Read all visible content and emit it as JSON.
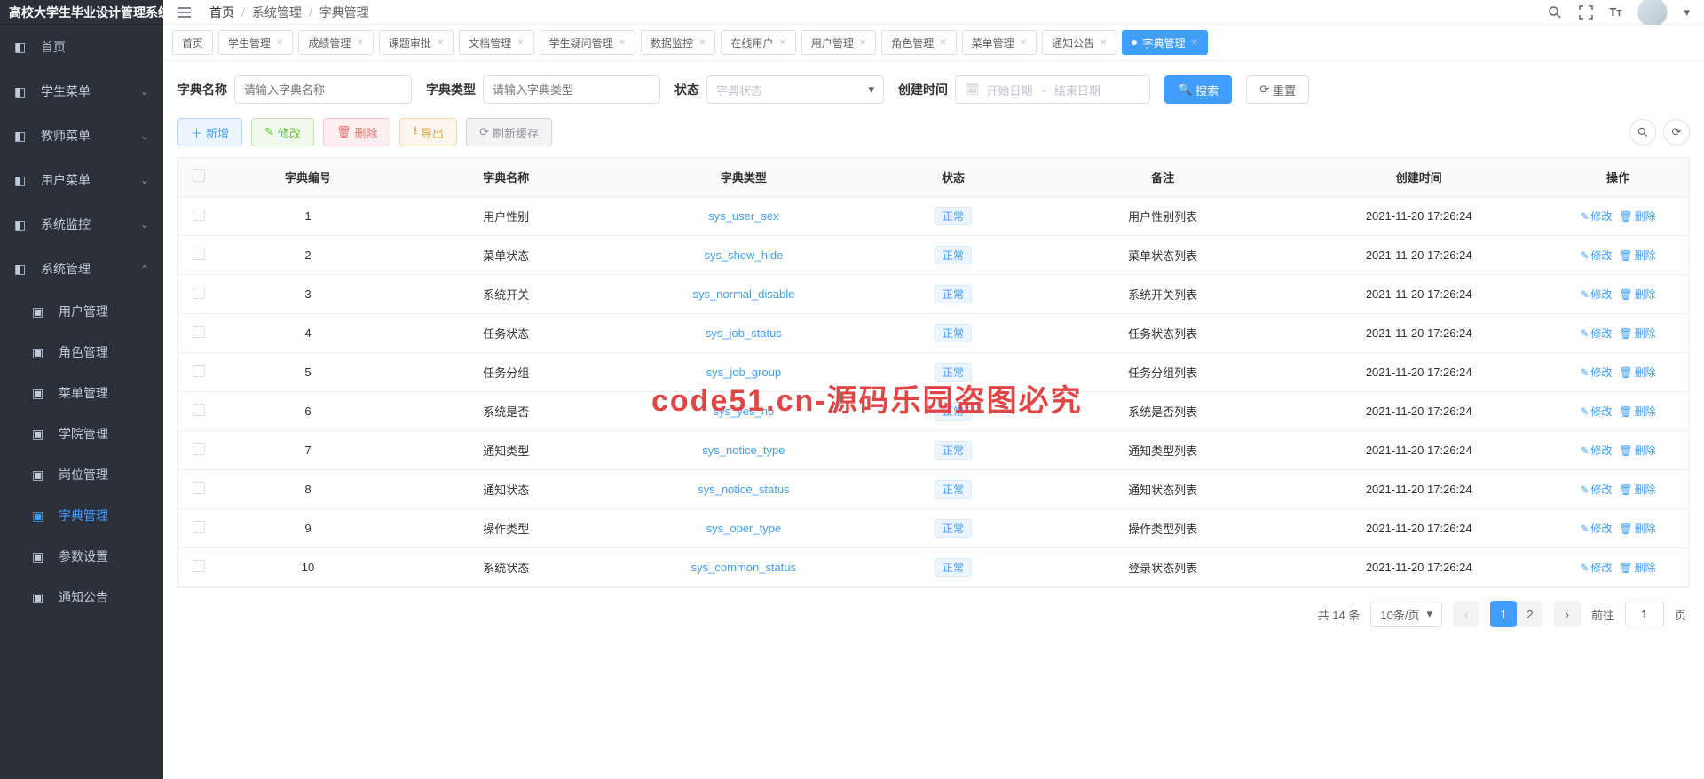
{
  "app_title": "高校大学生毕业设计管理系统",
  "breadcrumb": [
    "首页",
    "系统管理",
    "字典管理"
  ],
  "sidebar": [
    {
      "key": "home",
      "label": "首页",
      "icon": "dashboard-icon",
      "expandable": false
    },
    {
      "key": "student",
      "label": "学生菜单",
      "icon": "list-icon",
      "expandable": true
    },
    {
      "key": "teacher",
      "label": "教师菜单",
      "icon": "list-icon",
      "expandable": true
    },
    {
      "key": "user",
      "label": "用户菜单",
      "icon": "list-icon",
      "expandable": true
    },
    {
      "key": "monitor",
      "label": "系统监控",
      "icon": "monitor-icon",
      "expandable": true
    },
    {
      "key": "system",
      "label": "系统管理",
      "icon": "gear-icon",
      "expandable": true,
      "open": true,
      "children": [
        {
          "key": "user-mgmt",
          "label": "用户管理",
          "icon": "user-icon"
        },
        {
          "key": "role-mgmt",
          "label": "角色管理",
          "icon": "users-icon"
        },
        {
          "key": "menu-mgmt",
          "label": "菜单管理",
          "icon": "menu-icon"
        },
        {
          "key": "college-mgmt",
          "label": "学院管理",
          "icon": "org-icon"
        },
        {
          "key": "post-mgmt",
          "label": "岗位管理",
          "icon": "post-icon"
        },
        {
          "key": "dict-mgmt",
          "label": "字典管理",
          "icon": "dict-icon",
          "active": true
        },
        {
          "key": "param-mgmt",
          "label": "参数设置",
          "icon": "edit-icon"
        },
        {
          "key": "notice-mgmt",
          "label": "通知公告",
          "icon": "message-icon"
        }
      ]
    }
  ],
  "tabs": [
    {
      "label": "首页",
      "closable": false
    },
    {
      "label": "学生管理",
      "closable": true
    },
    {
      "label": "成绩管理",
      "closable": true
    },
    {
      "label": "课题审批",
      "closable": true
    },
    {
      "label": "文档管理",
      "closable": true
    },
    {
      "label": "学生疑问管理",
      "closable": true
    },
    {
      "label": "数据监控",
      "closable": true
    },
    {
      "label": "在线用户",
      "closable": true
    },
    {
      "label": "用户管理",
      "closable": true
    },
    {
      "label": "角色管理",
      "closable": true
    },
    {
      "label": "菜单管理",
      "closable": true
    },
    {
      "label": "通知公告",
      "closable": true
    },
    {
      "label": "字典管理",
      "closable": true,
      "active": true
    }
  ],
  "search": {
    "name_label": "字典名称",
    "name_placeholder": "请输入字典名称",
    "type_label": "字典类型",
    "type_placeholder": "请输入字典类型",
    "status_label": "状态",
    "status_placeholder": "字典状态",
    "time_label": "创建时间",
    "date_start_placeholder": "开始日期",
    "date_end_placeholder": "结束日期",
    "search_btn": "搜索",
    "reset_btn": "重置"
  },
  "toolbar": {
    "add": "新增",
    "edit": "修改",
    "delete": "删除",
    "export": "导出",
    "refresh_cache": "刷新缓存"
  },
  "table": {
    "headers": {
      "id": "字典编号",
      "name": "字典名称",
      "type": "字典类型",
      "status": "状态",
      "note": "备注",
      "time": "创建时间",
      "ops": "操作"
    },
    "status_tag": "正常",
    "op_edit": "修改",
    "op_delete": "删除",
    "rows": [
      {
        "id": 1,
        "name": "用户性别",
        "type": "sys_user_sex",
        "note": "用户性别列表",
        "time": "2021-11-20 17:26:24"
      },
      {
        "id": 2,
        "name": "菜单状态",
        "type": "sys_show_hide",
        "note": "菜单状态列表",
        "time": "2021-11-20 17:26:24"
      },
      {
        "id": 3,
        "name": "系统开关",
        "type": "sys_normal_disable",
        "note": "系统开关列表",
        "time": "2021-11-20 17:26:24"
      },
      {
        "id": 4,
        "name": "任务状态",
        "type": "sys_job_status",
        "note": "任务状态列表",
        "time": "2021-11-20 17:26:24"
      },
      {
        "id": 5,
        "name": "任务分组",
        "type": "sys_job_group",
        "note": "任务分组列表",
        "time": "2021-11-20 17:26:24"
      },
      {
        "id": 6,
        "name": "系统是否",
        "type": "sys_yes_no",
        "note": "系统是否列表",
        "time": "2021-11-20 17:26:24"
      },
      {
        "id": 7,
        "name": "通知类型",
        "type": "sys_notice_type",
        "note": "通知类型列表",
        "time": "2021-11-20 17:26:24"
      },
      {
        "id": 8,
        "name": "通知状态",
        "type": "sys_notice_status",
        "note": "通知状态列表",
        "time": "2021-11-20 17:26:24"
      },
      {
        "id": 9,
        "name": "操作类型",
        "type": "sys_oper_type",
        "note": "操作类型列表",
        "time": "2021-11-20 17:26:24"
      },
      {
        "id": 10,
        "name": "系统状态",
        "type": "sys_common_status",
        "note": "登录状态列表",
        "time": "2021-11-20 17:26:24"
      }
    ]
  },
  "pagination": {
    "total_prefix": "共",
    "total": 14,
    "total_suffix": "条",
    "page_size_label": "10条/页",
    "current": 1,
    "pages": [
      1,
      2
    ],
    "jump_prefix": "前往",
    "jump_value": 1,
    "jump_suffix": "页"
  },
  "watermark": "code51.cn-源码乐园盗图必究"
}
